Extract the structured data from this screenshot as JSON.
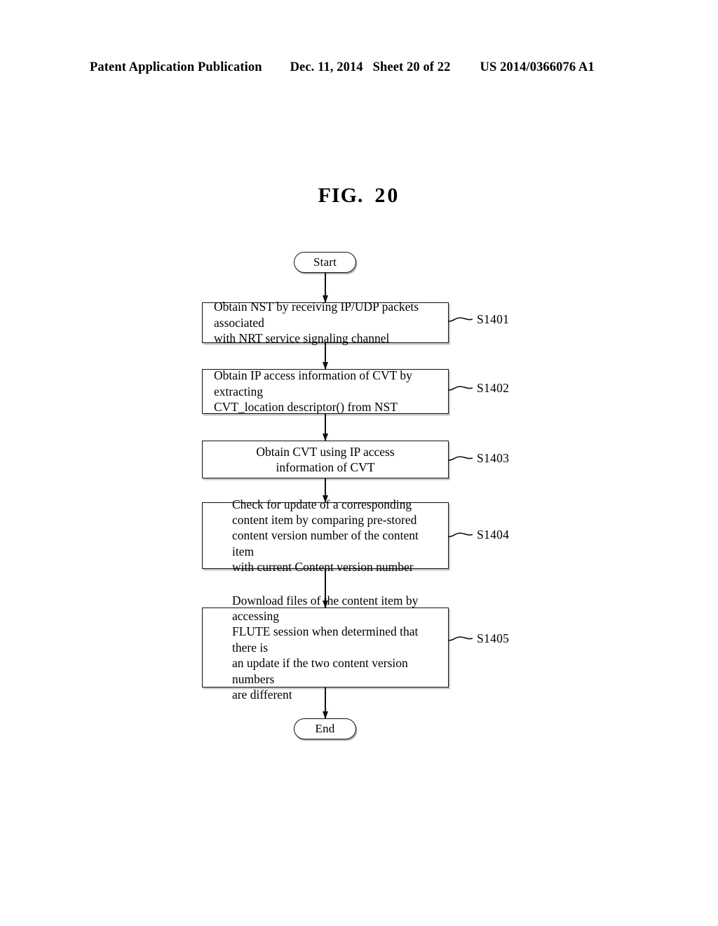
{
  "header": {
    "publication": "Patent Application Publication",
    "date": "Dec. 11, 2014",
    "sheet": "Sheet 20 of 22",
    "patent_number": "US 2014/0366076 A1"
  },
  "figure": {
    "label": "FIG.",
    "number": "20"
  },
  "flowchart": {
    "start_label": "Start",
    "end_label": "End",
    "steps": [
      {
        "id": "S1401",
        "text": "Obtain NST by receiving IP/UDP packets associated\nwith NRT service signaling channel",
        "align": "left"
      },
      {
        "id": "S1402",
        "text": "Obtain IP access information of CVT by extracting\nCVT_location descriptor() from NST",
        "align": "left"
      },
      {
        "id": "S1403",
        "text": "Obtain CVT using IP access\ninformation of CVT",
        "align": "center"
      },
      {
        "id": "S1404",
        "text": "Check for update of a corresponding\ncontent item by comparing pre-stored\ncontent version number of the content item\nwith current Content version number",
        "align": "indent"
      },
      {
        "id": "S1405",
        "text": "Download files of the content item by accessing\nFLUTE session when determined that there is\nan update if the two content version numbers\nare different",
        "align": "indent"
      }
    ]
  },
  "colors": {
    "ink": "#111111",
    "paper": "#ffffff"
  }
}
